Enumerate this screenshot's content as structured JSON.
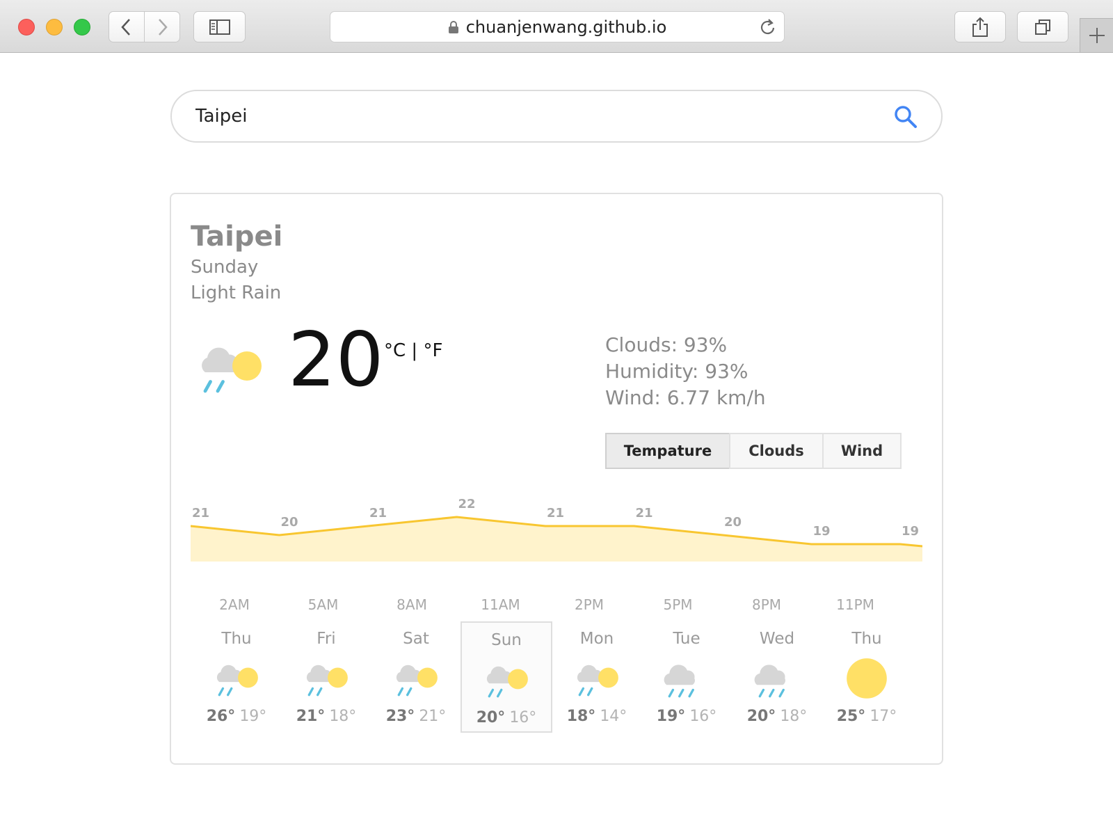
{
  "browser": {
    "url": "chuanjenwang.github.io",
    "icons": [
      "back-icon",
      "forward-icon",
      "sidebar-icon",
      "lock-icon",
      "reload-icon",
      "share-icon",
      "tabs-icon",
      "plus-icon"
    ]
  },
  "search": {
    "value": "Taipei",
    "icon": "search-icon",
    "accent_color": "#4285f4"
  },
  "weather": {
    "city": "Taipei",
    "day": "Sunday",
    "condition": "Light Rain",
    "current_temp": "20",
    "units": {
      "celsius": "°C",
      "separator": "|",
      "fahrenheit": "°F"
    },
    "current_icon": "rain-sun-icon",
    "stats": {
      "clouds": "Clouds: 93%",
      "humidity": "Humidity: 93%",
      "wind": "Wind: 6.77 km/h"
    },
    "tabs": [
      "Tempature",
      "Clouds",
      "Wind"
    ],
    "active_tab": "Tempature"
  },
  "chart_data": {
    "type": "area",
    "x": [
      "2AM",
      "5AM",
      "8AM",
      "11AM",
      "2PM",
      "5PM",
      "8PM",
      "11PM"
    ],
    "values": [
      21,
      20,
      21,
      22,
      21,
      21,
      20,
      19,
      19
    ],
    "line_color": "#f8c630",
    "fill_color": "#fff3cc"
  },
  "forecast": [
    {
      "day": "Thu",
      "high": "26°",
      "low": "19°",
      "icon": "rain-sun-icon",
      "selected": false
    },
    {
      "day": "Fri",
      "high": "21°",
      "low": "18°",
      "icon": "rain-sun-icon",
      "selected": false
    },
    {
      "day": "Sat",
      "high": "23°",
      "low": "21°",
      "icon": "rain-sun-icon",
      "selected": false
    },
    {
      "day": "Sun",
      "high": "20°",
      "low": "16°",
      "icon": "rain-sun-icon",
      "selected": true
    },
    {
      "day": "Mon",
      "high": "18°",
      "low": "14°",
      "icon": "rain-sun-icon",
      "selected": false
    },
    {
      "day": "Tue",
      "high": "19°",
      "low": "16°",
      "icon": "rain-cloud-icon",
      "selected": false
    },
    {
      "day": "Wed",
      "high": "20°",
      "low": "18°",
      "icon": "rain-cloud-icon",
      "selected": false
    },
    {
      "day": "Thu",
      "high": "25°",
      "low": "17°",
      "icon": "sun-icon",
      "selected": false
    }
  ]
}
